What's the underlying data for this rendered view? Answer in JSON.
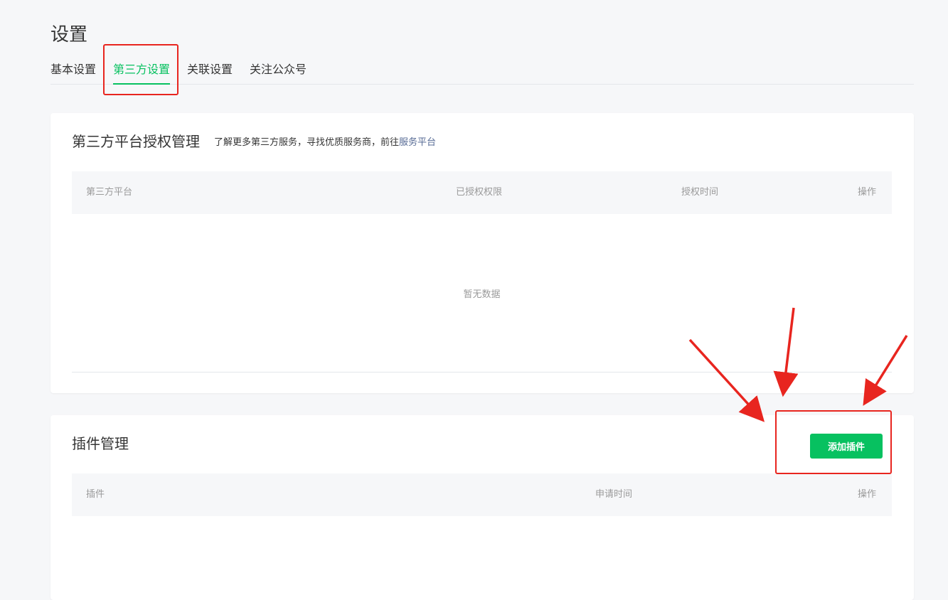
{
  "page": {
    "title": "设置"
  },
  "tabs": [
    {
      "label": "基本设置",
      "active": false
    },
    {
      "label": "第三方设置",
      "active": true
    },
    {
      "label": "关联设置",
      "active": false
    },
    {
      "label": "关注公众号",
      "active": false
    }
  ],
  "auth_section": {
    "title": "第三方平台授权管理",
    "desc_prefix": "了解更多第三方服务，寻找优质服务商，前往",
    "desc_link": "服务平台",
    "columns": [
      "第三方平台",
      "已授权权限",
      "授权时间",
      "操作"
    ],
    "empty_text": "暂无数据"
  },
  "plugin_section": {
    "title": "插件管理",
    "add_button": "添加插件",
    "columns": [
      "插件",
      "申请时间",
      "操作"
    ]
  },
  "colors": {
    "accent": "#07c160",
    "link": "#576b95",
    "annotation": "#e8251f"
  }
}
